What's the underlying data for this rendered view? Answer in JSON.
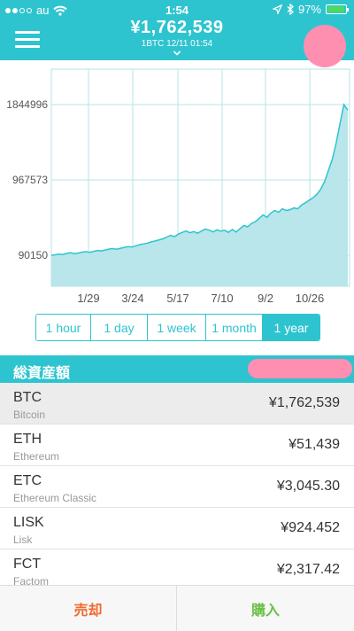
{
  "status": {
    "carrier": "au",
    "time": "1:54",
    "battery_pct": "97%",
    "battery_level": 0.97
  },
  "header": {
    "price": "¥1,762,539",
    "subtitle": "1BTC   12/11 01:54"
  },
  "chart_data": {
    "type": "area",
    "y_ticks": [
      1844996,
      967573,
      90150
    ],
    "y_tick_labels": [
      "1844996",
      "967573",
      "90150"
    ],
    "x_tick_labels": [
      "1/29",
      "3/24",
      "5/17",
      "7/10",
      "9/2",
      "10/26"
    ],
    "ylim": [
      90150,
      1844996
    ],
    "values": [
      90150,
      95000,
      103000,
      98000,
      112000,
      120000,
      109000,
      116000,
      126000,
      131000,
      124000,
      136000,
      146000,
      141000,
      151000,
      162000,
      168000,
      160000,
      172000,
      182000,
      191000,
      186000,
      201000,
      214000,
      222000,
      232000,
      246000,
      256000,
      270000,
      282000,
      302000,
      322000,
      306000,
      336000,
      356000,
      372000,
      352000,
      366000,
      346000,
      372000,
      396000,
      382000,
      362000,
      386000,
      370000,
      381000,
      356000,
      391000,
      361000,
      401000,
      436000,
      421000,
      461000,
      481000,
      521000,
      561000,
      531000,
      581000,
      611000,
      591000,
      631000,
      611000,
      621000,
      641000,
      631000,
      676000,
      701000,
      731000,
      761000,
      801000,
      861000,
      951000,
      1081000,
      1211000,
      1401000,
      1630000,
      1844996,
      1780000
    ],
    "line_color": "#2ec4cf",
    "fill_color": "#b8e6ea",
    "grid": true
  },
  "range": {
    "options": [
      "1 hour",
      "1 day",
      "1 week",
      "1 month",
      "1 year"
    ],
    "selected": "1 year"
  },
  "assets": {
    "title": "総資産額"
  },
  "coins": [
    {
      "symbol": "BTC",
      "name": "Bitcoin",
      "value": "¥1,762,539"
    },
    {
      "symbol": "ETH",
      "name": "Ethereum",
      "value": "¥51,439"
    },
    {
      "symbol": "ETC",
      "name": "Ethereum Classic",
      "value": "¥3,045.30"
    },
    {
      "symbol": "LISK",
      "name": "Lisk",
      "value": "¥924.452"
    },
    {
      "symbol": "FCT",
      "name": "Factom",
      "value": "¥2,317.42"
    }
  ],
  "actions": {
    "sell": "売却",
    "buy": "購入"
  },
  "colors": {
    "accent": "#2ec4cf",
    "sell": "#ef6a2f",
    "buy": "#6cc04a",
    "redaction": "#ff8fb1"
  }
}
